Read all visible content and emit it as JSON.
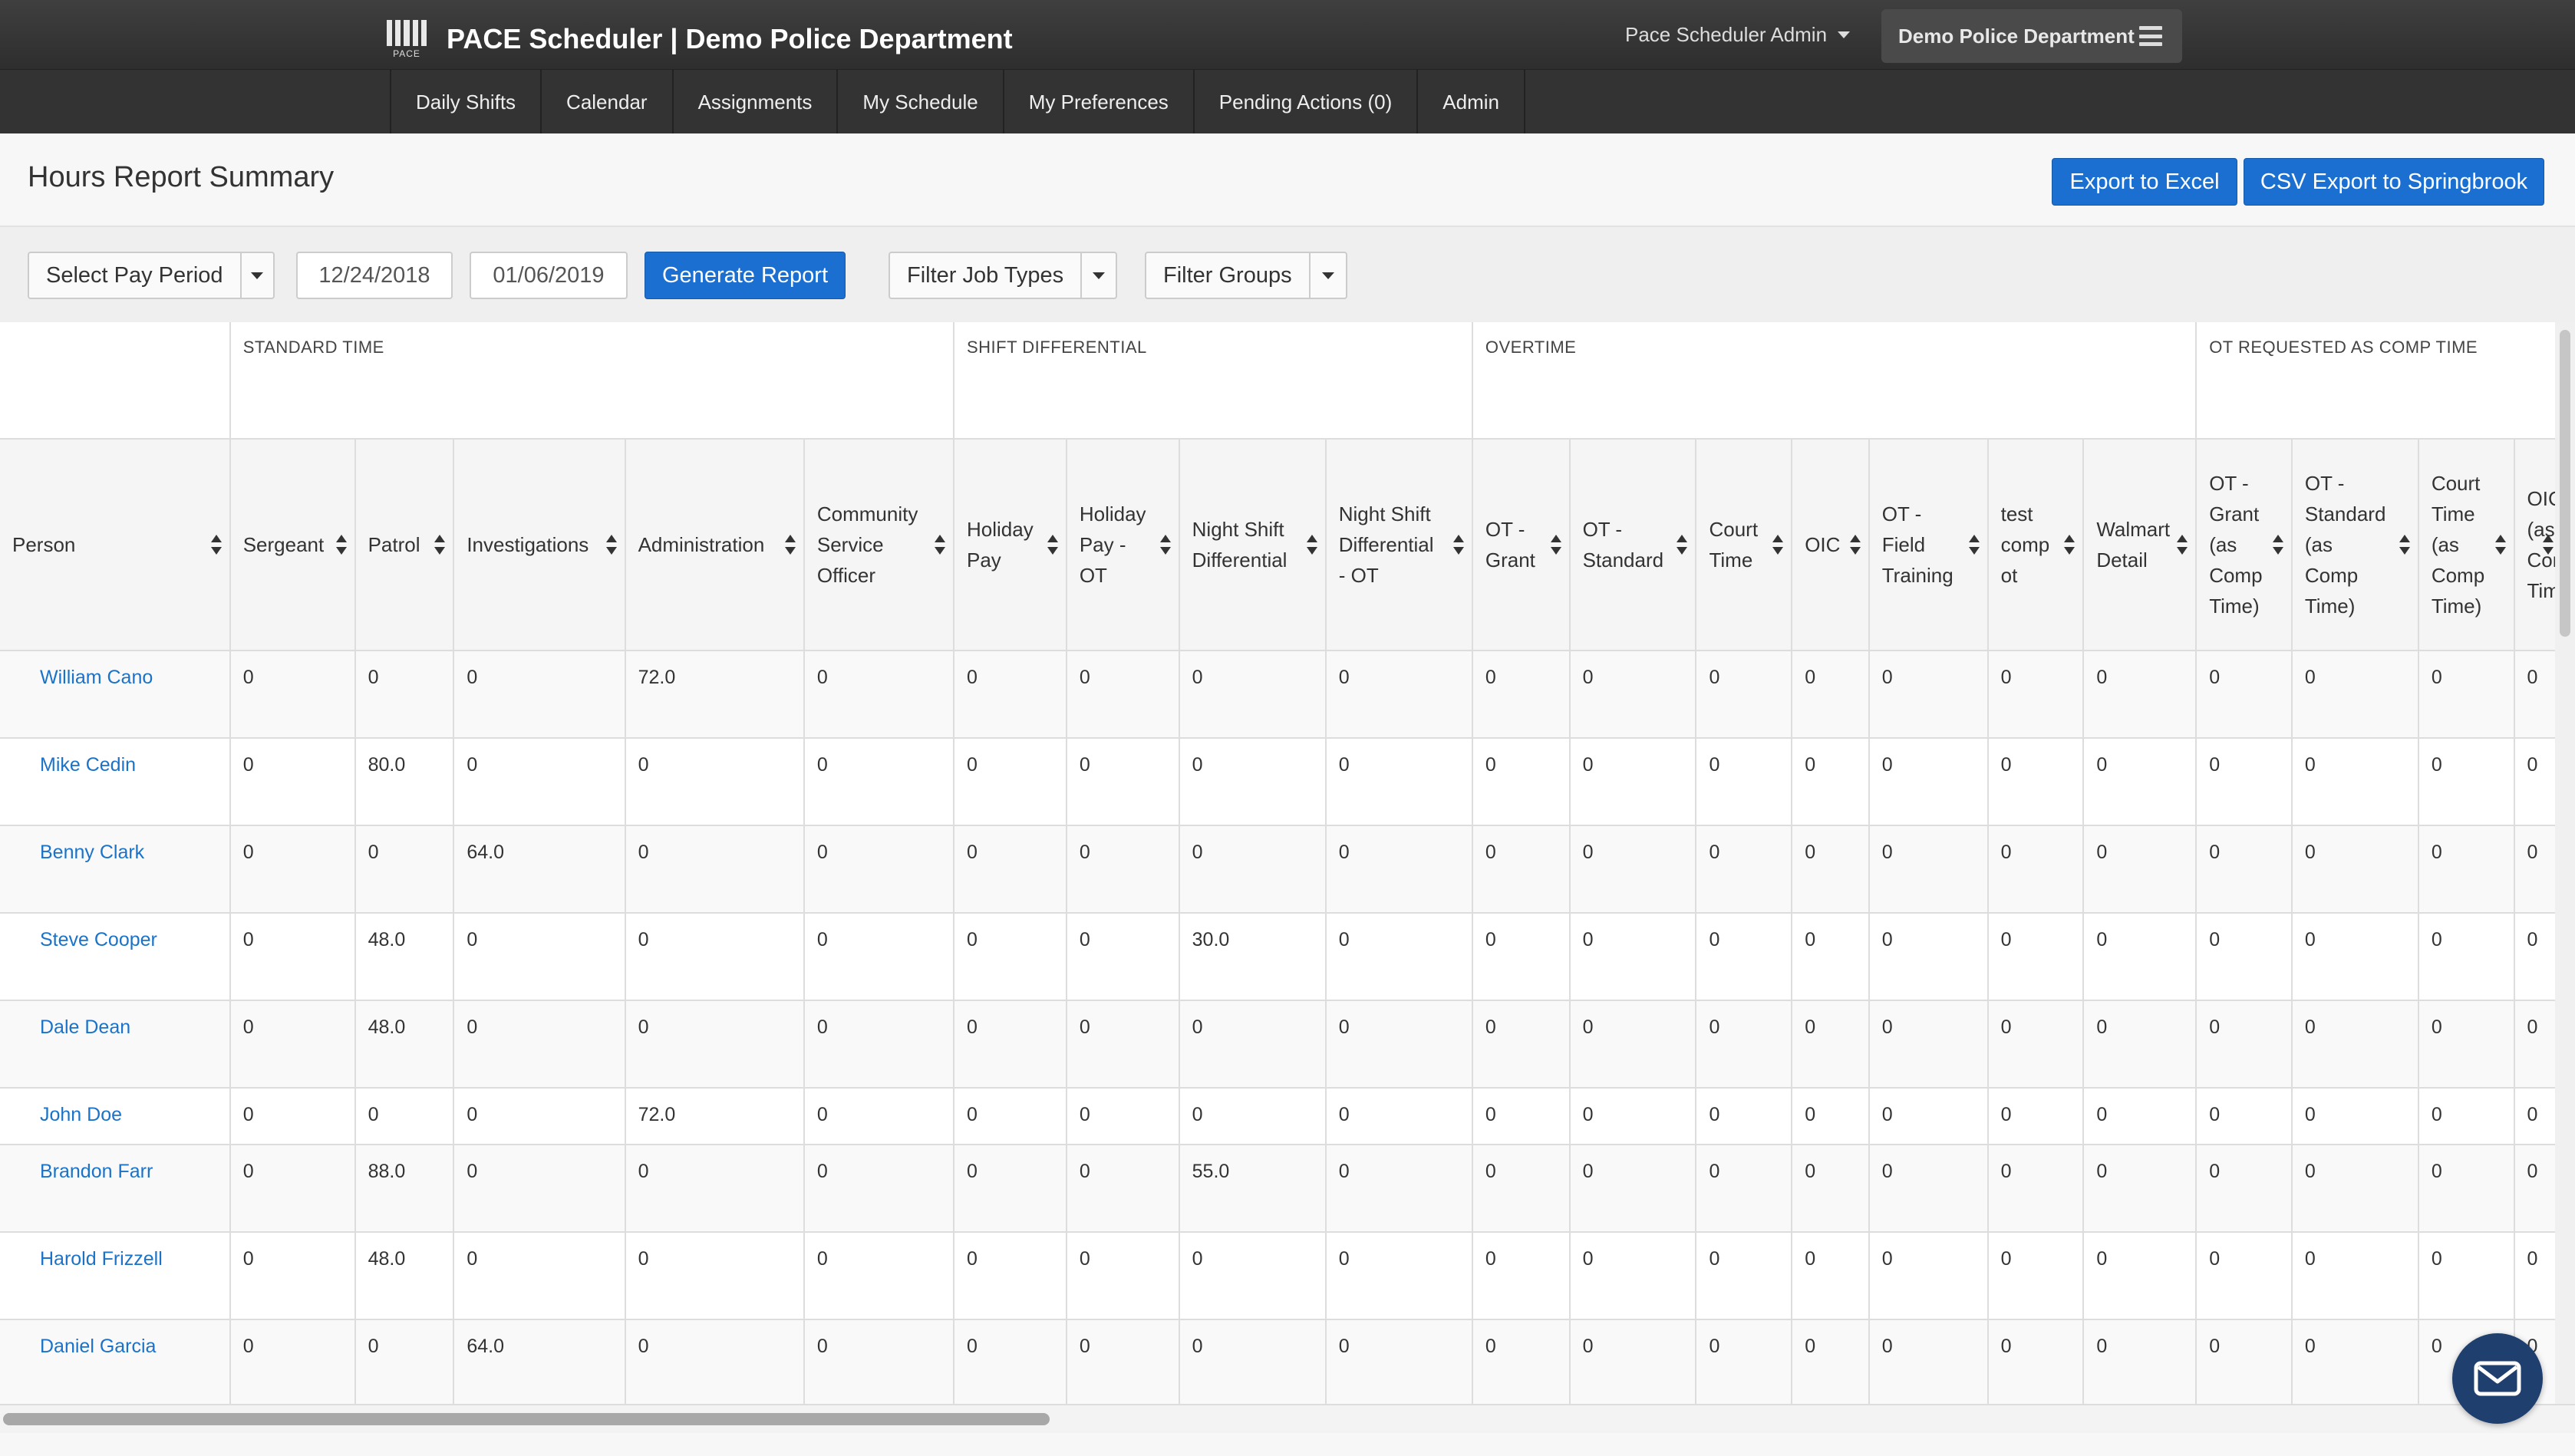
{
  "navbar": {
    "logo_text": "PACE",
    "title": "PACE Scheduler | Demo Police Department",
    "user_menu": "Pace Scheduler Admin",
    "department": "Demo Police Department"
  },
  "subnav": {
    "items": [
      "Daily Shifts",
      "Calendar",
      "Assignments",
      "My Schedule",
      "My Preferences",
      "Pending Actions (0)",
      "Admin"
    ]
  },
  "page": {
    "title": "Hours Report Summary",
    "export_excel": "Export to Excel",
    "export_csv": "CSV Export to Springbrook"
  },
  "filters": {
    "pay_period": "Select Pay Period",
    "start_date": "12/24/2018",
    "end_date": "01/06/2019",
    "generate": "Generate Report",
    "job_types": "Filter Job Types",
    "groups": "Filter Groups"
  },
  "table": {
    "groups": [
      {
        "label": "",
        "span": 1
      },
      {
        "label": "STANDARD TIME",
        "span": 5
      },
      {
        "label": "SHIFT DIFFERENTIAL",
        "span": 4
      },
      {
        "label": "OVERTIME",
        "span": 7
      },
      {
        "label": "OT REQUESTED AS COMP TIME",
        "span": 4
      }
    ],
    "columns": [
      "Person",
      "Sergeant",
      "Patrol",
      "Investigations",
      "Administration",
      "Community Service Officer",
      "Holiday Pay",
      "Holiday Pay - OT",
      "Night Shift Differential",
      "Night Shift Differential - OT",
      "OT - Grant",
      "OT - Standard",
      "Court Time",
      "OIC",
      "OT - Field Training",
      "test comp ot",
      "Walmart Detail",
      "OT - Grant (as Comp Time)",
      "OT - Standard (as Comp Time)",
      "Court Time (as Comp Time)",
      "OIC (as Comp Time)"
    ],
    "rows": [
      [
        "William Cano",
        "0",
        "0",
        "0",
        "72.0",
        "0",
        "0",
        "0",
        "0",
        "0",
        "0",
        "0",
        "0",
        "0",
        "0",
        "0",
        "0",
        "0",
        "0",
        "0",
        "0"
      ],
      [
        "Mike Cedin",
        "0",
        "80.0",
        "0",
        "0",
        "0",
        "0",
        "0",
        "0",
        "0",
        "0",
        "0",
        "0",
        "0",
        "0",
        "0",
        "0",
        "0",
        "0",
        "0",
        "0"
      ],
      [
        "Benny Clark",
        "0",
        "0",
        "64.0",
        "0",
        "0",
        "0",
        "0",
        "0",
        "0",
        "0",
        "0",
        "0",
        "0",
        "0",
        "0",
        "0",
        "0",
        "0",
        "0",
        "0"
      ],
      [
        "Steve Cooper",
        "0",
        "48.0",
        "0",
        "0",
        "0",
        "0",
        "0",
        "30.0",
        "0",
        "0",
        "0",
        "0",
        "0",
        "0",
        "0",
        "0",
        "0",
        "0",
        "0",
        "0"
      ],
      [
        "Dale Dean",
        "0",
        "48.0",
        "0",
        "0",
        "0",
        "0",
        "0",
        "0",
        "0",
        "0",
        "0",
        "0",
        "0",
        "0",
        "0",
        "0",
        "0",
        "0",
        "0",
        "0"
      ],
      [
        "John Doe",
        "0",
        "0",
        "0",
        "72.0",
        "0",
        "0",
        "0",
        "0",
        "0",
        "0",
        "0",
        "0",
        "0",
        "0",
        "0",
        "0",
        "0",
        "0",
        "0",
        "0"
      ],
      [
        "Brandon Farr",
        "0",
        "88.0",
        "0",
        "0",
        "0",
        "0",
        "0",
        "55.0",
        "0",
        "0",
        "0",
        "0",
        "0",
        "0",
        "0",
        "0",
        "0",
        "0",
        "0",
        "0"
      ],
      [
        "Harold Frizzell",
        "0",
        "48.0",
        "0",
        "0",
        "0",
        "0",
        "0",
        "0",
        "0",
        "0",
        "0",
        "0",
        "0",
        "0",
        "0",
        "0",
        "0",
        "0",
        "0",
        "0"
      ],
      [
        "Daniel Garcia",
        "0",
        "0",
        "64.0",
        "0",
        "0",
        "0",
        "0",
        "0",
        "0",
        "0",
        "0",
        "0",
        "0",
        "0",
        "0",
        "0",
        "0",
        "0",
        "0",
        "0"
      ]
    ]
  },
  "colors": {
    "primary": "#1a6fd1",
    "link": "#1a73c9",
    "navbar": "#333333",
    "chat": "#1f3f6e"
  }
}
